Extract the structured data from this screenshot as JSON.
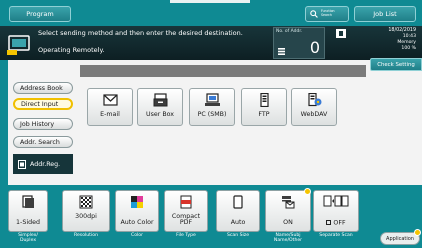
{
  "topbar": {
    "program_label": "Program",
    "search_line1": "Function",
    "search_line2": "Search",
    "joblist_label": "Job List"
  },
  "message": {
    "line1": "Select sending method and then enter the desired destination.",
    "line2": "Operating Remotely."
  },
  "address": {
    "label": "No. of Addr.",
    "count": "0"
  },
  "status": {
    "date": "18/02/2019",
    "time": "10:43",
    "memory_label": "Memory",
    "memory_value": "100 %"
  },
  "check_setting_label": "Check Setting",
  "menu": {
    "items": [
      {
        "label": "Address Book"
      },
      {
        "label": "Direct Input"
      },
      {
        "label": "Job History"
      },
      {
        "label": "Addr. Search"
      }
    ],
    "active_index": 1,
    "addr_reg_label": "Addr.Reg."
  },
  "destinations": [
    {
      "label": "E-mail",
      "icon": "envelope-icon"
    },
    {
      "label": "User Box",
      "icon": "user-box-icon"
    },
    {
      "label": "PC (SMB)",
      "icon": "pc-icon"
    },
    {
      "label": "FTP",
      "icon": "ftp-icon"
    },
    {
      "label": "WebDAV",
      "icon": "webdav-icon"
    }
  ],
  "settings": [
    {
      "value": "1-Sided",
      "label": "Simplex/\nDuplex",
      "icon": "simplex-icon"
    },
    {
      "value": "300dpi",
      "label": "Resolution",
      "icon": "resolution-icon"
    },
    {
      "value": "Auto Color",
      "label": "Color",
      "icon": "color-icon"
    },
    {
      "value": "Compact\nPDF",
      "label": "File Type",
      "icon": "pdf-icon"
    },
    {
      "value": "Auto",
      "label": "Scan Size",
      "icon": "page-icon"
    },
    {
      "value": "ON",
      "label": "Name/Subj\nName/Other",
      "icon": "mail-text-icon"
    },
    {
      "value": "OFF",
      "label": "Separate Scan",
      "icon": "separate-scan-icon"
    }
  ],
  "application_label": "Application",
  "colors": {
    "teal": "#0f8a93",
    "dark": "#16353a",
    "accent_yellow": "#f5c400"
  }
}
